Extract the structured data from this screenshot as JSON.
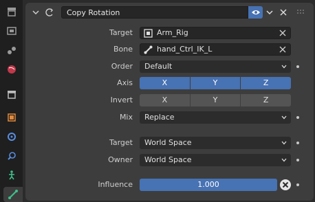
{
  "header": {
    "constraint_name": "Copy Rotation"
  },
  "fields": {
    "target_label": "Target",
    "target_value": "Arm_Rig",
    "bone_label": "Bone",
    "bone_value": "hand_Ctrl_IK_L",
    "order_label": "Order",
    "order_value": "Default",
    "axis_label": "Axis",
    "axis_options": [
      "X",
      "Y",
      "Z"
    ],
    "invert_label": "Invert",
    "invert_options": [
      "X",
      "Y",
      "Z"
    ],
    "mix_label": "Mix",
    "mix_value": "Replace",
    "target_space_label": "Target",
    "target_space_value": "World Space",
    "owner_space_label": "Owner",
    "owner_space_value": "World Space",
    "influence_label": "Influence",
    "influence_value": "1.000",
    "influence_fraction": 1.0
  },
  "colors": {
    "accent": "#4772b3",
    "panel": "#3d3d3d",
    "background": "#2b2b2b"
  },
  "sidebar_icons": [
    "tool-icon",
    "render-icon",
    "output-icon",
    "view-layer-icon",
    "scene-icon",
    "world-icon",
    "collection-icon",
    "object-icon",
    "modifier-icon",
    "particles-icon",
    "physics-icon",
    "constraint-icon",
    "bone-icon"
  ]
}
